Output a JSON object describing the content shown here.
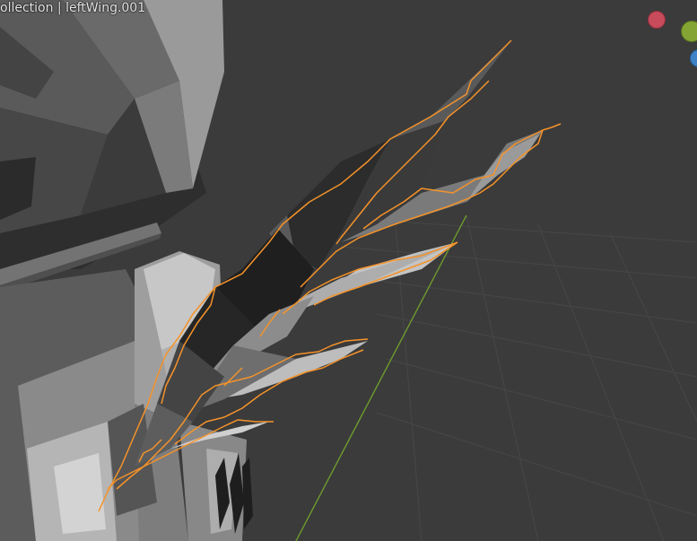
{
  "viewport": {
    "header_text": "ollection | leftWing.001",
    "gizmo": {
      "x_axis_color": "#c74b5a",
      "y_axis_color": "#84a534",
      "z_axis_color": "#3f83c7"
    },
    "selection_outline_color": "#f5932a",
    "grid_axis_color": "#6d9a2e"
  }
}
